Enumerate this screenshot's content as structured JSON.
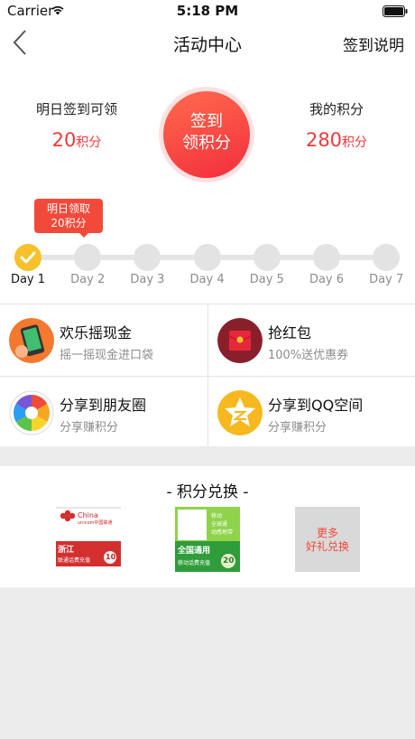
{
  "status": {
    "carrier": "Carrier",
    "time": "5:18 PM"
  },
  "nav": {
    "title": "活动中心",
    "right": "签到说明"
  },
  "summary": {
    "tomorrow_label": "明日签到可领",
    "tomorrow_value": "20",
    "tomorrow_unit": "积分",
    "mine_label": "我的积分",
    "mine_value": "280",
    "mine_unit": "积分"
  },
  "signin": {
    "line1": "签到",
    "line2": "领积分"
  },
  "tooltip": {
    "line1": "明日领取",
    "line2": "20积分"
  },
  "progress": {
    "days": [
      "Day 1",
      "Day 2",
      "Day 3",
      "Day 4",
      "Day 5",
      "Day 6",
      "Day 7"
    ],
    "completed_days": 1
  },
  "activities": [
    {
      "title": "欢乐摇现金",
      "subtitle": "摇一摇现金进口袋",
      "icon": "shake-phone-icon"
    },
    {
      "title": "抢红包",
      "subtitle": "100%送优惠券",
      "icon": "red-envelope-icon"
    },
    {
      "title": "分享到朋友圈",
      "subtitle": "分享赚积分",
      "icon": "moments-icon"
    },
    {
      "title": "分享到QQ空间",
      "subtitle": "分享赚积分",
      "icon": "qzone-icon"
    }
  ],
  "exchange": {
    "title": "- 积分兑换 -",
    "cards": [
      {
        "brand_en": "China",
        "brand_en2": "unicom中国联通",
        "region": "浙江",
        "desc": "联通话费充值",
        "value": "10"
      },
      {
        "banner": "全国通用",
        "desc": "移动话费充值",
        "value": "20",
        "tag1": "移动",
        "tag2": "全球通",
        "tag3": "动感地带"
      },
      {
        "line1": "更多",
        "line2": "好礼兑换"
      }
    ]
  },
  "colors": {
    "accent": "#f03a3a",
    "gold": "#f6c12a",
    "tooltip": "#f24a3a"
  }
}
